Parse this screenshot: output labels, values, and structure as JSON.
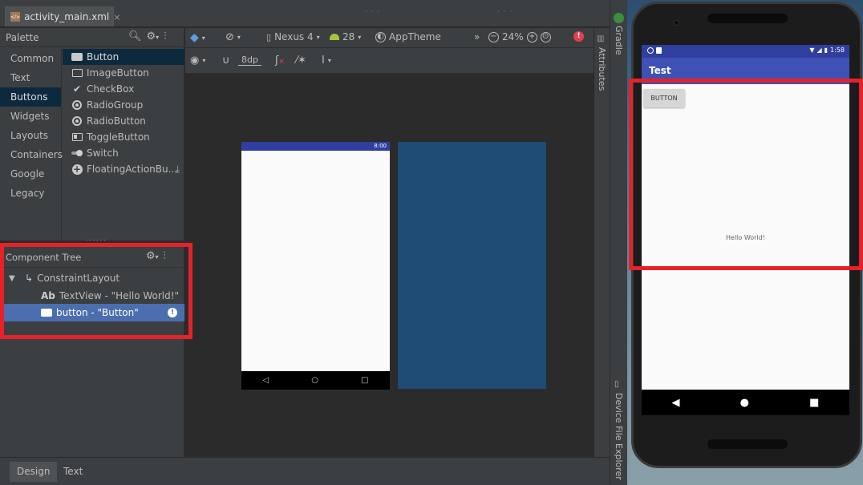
{
  "editor": {
    "file_tab": "activity_main.xml",
    "file_icon": "xml-file-icon"
  },
  "palette": {
    "title": "Palette",
    "categories": [
      "Common",
      "Text",
      "Buttons",
      "Widgets",
      "Layouts",
      "Containers",
      "Google",
      "Legacy"
    ],
    "selected_category": "Buttons",
    "items": [
      "Button",
      "ImageButton",
      "CheckBox",
      "RadioGroup",
      "RadioButton",
      "ToggleButton",
      "Switch",
      "FloatingActionBu..."
    ]
  },
  "component_tree": {
    "title": "Component Tree",
    "root": "ConstraintLayout",
    "children": [
      {
        "prefix": "Ab",
        "label": "TextView - \"Hello World!\""
      },
      {
        "label": "button - \"Button\""
      }
    ]
  },
  "toolbar": {
    "device": "Nexus 4",
    "api": "28",
    "theme": "AppTheme",
    "zoom": "24%",
    "margin": "8dp",
    "overflow": "»"
  },
  "design_preview": {
    "time": "8:00"
  },
  "side_tools": {
    "attributes": "Attributes",
    "gradle": "Gradle",
    "device_explorer": "Device File Explorer"
  },
  "bottom_tabs": [
    "Design",
    "Text"
  ],
  "emulator": {
    "time": "1:58",
    "app_title": "Test",
    "button_label": "BUTTON",
    "hello_text": "Hello World!"
  },
  "colors": {
    "highlight": "#e5222a",
    "selection": "#4b6eaf",
    "primary": "#3f51b5",
    "primary_dark": "#303f9f",
    "blueprint": "#1f4c72"
  }
}
